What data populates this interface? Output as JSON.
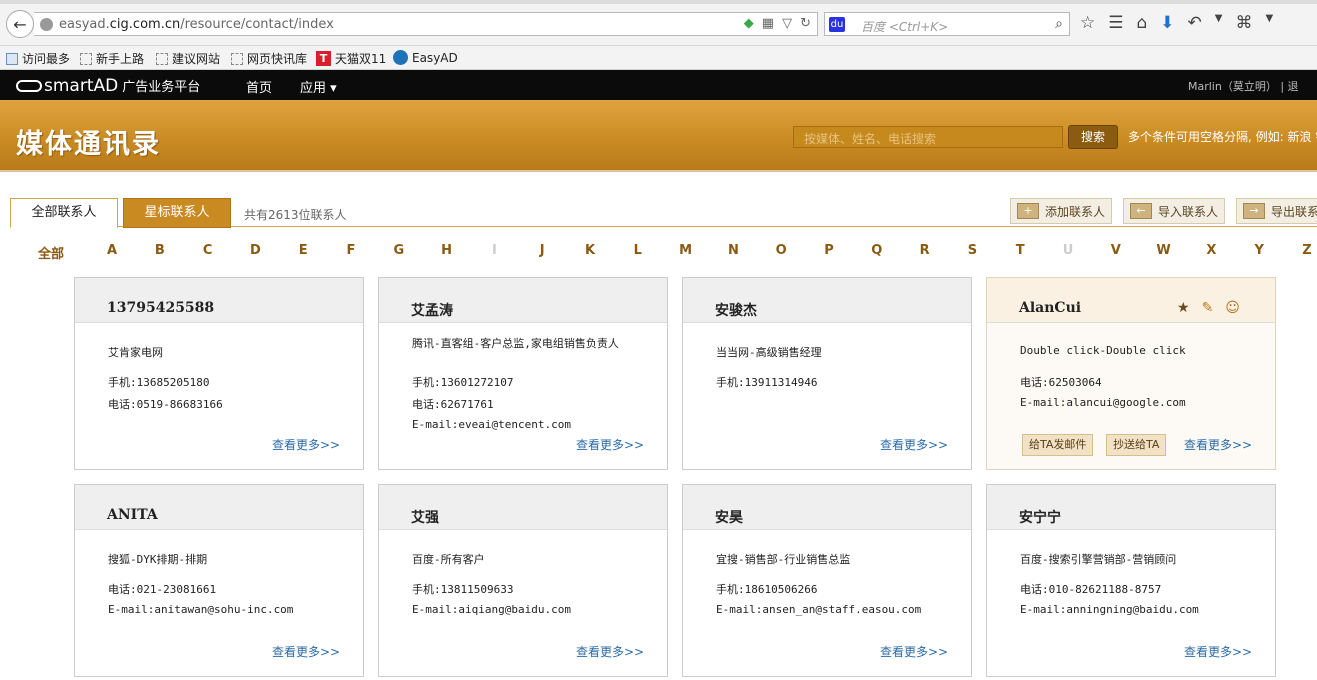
{
  "browser": {
    "url_prefix": "easyad.",
    "url_domain": "cig.com.cn",
    "url_path": "/resource/contact/index",
    "search_placeholder": "百度 <Ctrl+K>",
    "bookmarks": [
      "访问最多",
      "新手上路",
      "建议网站",
      "网页快讯库",
      "天猫双11",
      "EasyAD"
    ]
  },
  "site": {
    "logo": "smartAD",
    "logo_sub": "广告业务平台",
    "nav": [
      "首页",
      "应用 ▾"
    ],
    "user": "Marlin（莫立明）  |  退"
  },
  "header": {
    "title": "媒体通讯录",
    "search_placeholder": "按媒体、姓名、电话搜索",
    "search_button": "搜索",
    "hint": "多个条件可用空格分隔, 例如: 新浪 销"
  },
  "tabs": {
    "all": "全部联系人",
    "starred": "星标联系人",
    "count": "共有2613位联系人"
  },
  "actions": {
    "add": "添加联系人",
    "import": "导入联系人",
    "export": "导出联系人"
  },
  "letters": {
    "all": "全部",
    "items": [
      "A",
      "B",
      "C",
      "D",
      "E",
      "F",
      "G",
      "H",
      "I",
      "J",
      "K",
      "L",
      "M",
      "N",
      "O",
      "P",
      "Q",
      "R",
      "S",
      "T",
      "U",
      "V",
      "W",
      "X",
      "Y",
      "Z"
    ]
  },
  "cards": [
    {
      "name": "13795425588",
      "lines": [
        "艾肯家电网",
        "手机:13685205180",
        "电话:0519-86683166"
      ],
      "more": "查看更多>>"
    },
    {
      "name": "艾孟涛",
      "lines": [
        "腾讯-直客组-客户总监,家电组销售负责人",
        "手机:13601272107",
        "电话:62671761",
        "E-mail:eveai@tencent.com"
      ],
      "more": "查看更多>>"
    },
    {
      "name": "安骏杰",
      "lines": [
        "当当网-高级销售经理",
        "手机:13911314946"
      ],
      "more": "查看更多>>"
    },
    {
      "name": "AlanCui",
      "lines": [
        "Double click-Double click",
        "电话:62503064",
        "E-mail:alancui@google.com"
      ],
      "more": "查看更多>>",
      "btn1": "给TA发邮件",
      "btn2": "抄送给TA"
    },
    {
      "name": "ANITA",
      "lines": [
        "搜狐-DYK排期-排期",
        "电话:021-23081661",
        "E-mail:anitawan@sohu-inc.com"
      ],
      "more": "查看更多>>"
    },
    {
      "name": "艾强",
      "lines": [
        "百度-所有客户",
        "手机:13811509633",
        "E-mail:aiqiang@baidu.com"
      ],
      "more": "查看更多>>"
    },
    {
      "name": "安昊",
      "lines": [
        "宜搜-销售部-行业销售总监",
        "手机:18610506266",
        "E-mail:ansen_an@staff.easou.com"
      ],
      "more": "查看更多>>"
    },
    {
      "name": "安宁宁",
      "lines": [
        "百度-搜索引擎营销部-营销顾问",
        "电话:010-82621188-8757",
        "E-mail:anningning@baidu.com"
      ],
      "more": "查看更多>>"
    }
  ],
  "colors": {
    "accent": "#c98a22",
    "link": "#2c6aa5",
    "topbar": "#0b0b0b"
  }
}
